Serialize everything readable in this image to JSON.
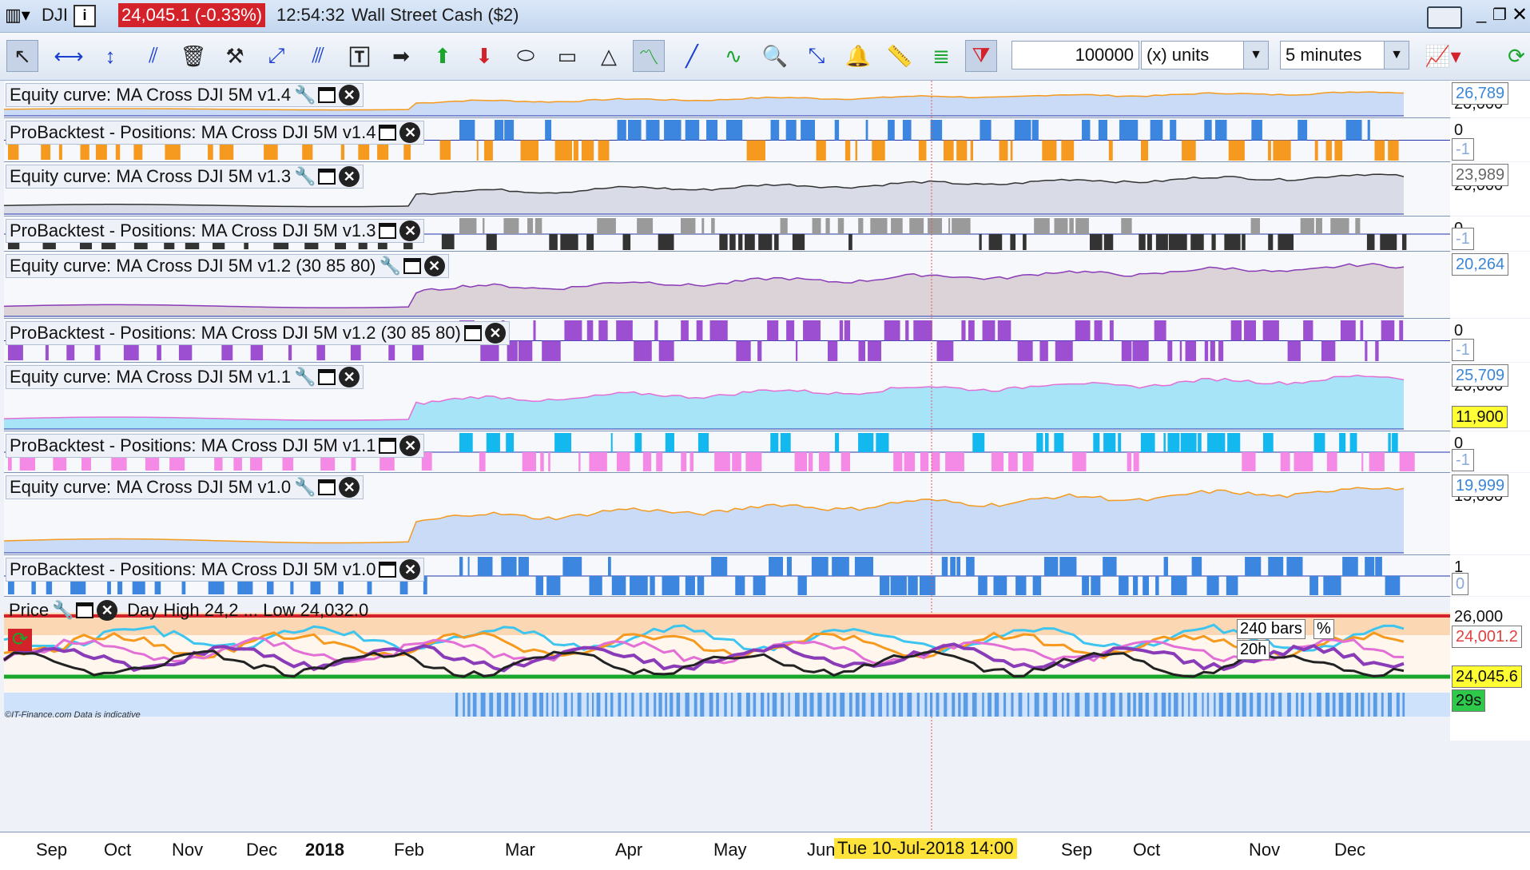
{
  "window": {
    "symbol": "DJI",
    "price_change": "24,045.1 (-0.33%)",
    "time": "12:54:32",
    "instrument": "Wall Street Cash ($2)"
  },
  "toolbar": {
    "quantity": "100000",
    "units_label": "(x) units",
    "timeframe": "5 minutes"
  },
  "panels": [
    {
      "label": "Equity curve: MA Cross DJI 5M v1.4",
      "axis_value": "26,789",
      "axis_tick": "20,000",
      "fill": "#c9dbf6",
      "line": "#f59a1e"
    },
    {
      "label": "ProBacktest - Positions: MA Cross DJI 5M v1.4",
      "axis_tick": "0",
      "axis_value": "-1",
      "bar_top": "#3d86e0",
      "bar_bottom": "#f59a1e"
    },
    {
      "label": "Equity curve: MA Cross DJI 5M v1.3",
      "axis_value": "23,989",
      "axis_tick": "20,000",
      "fill": "#d9dce6",
      "line": "#333333"
    },
    {
      "label": "ProBacktest - Positions: MA Cross DJI 5M v1.3",
      "axis_tick": "0",
      "axis_value": "-1",
      "bar_top": "#9a9a9a",
      "bar_bottom": "#333333"
    },
    {
      "label": "Equity curve: MA Cross DJI 5M v1.2 (30 85 80)",
      "axis_value": "20,264",
      "axis_tick": "",
      "fill": "#dcd3d8",
      "line": "#8a3bb8"
    },
    {
      "label": "ProBacktest - Positions: MA Cross DJI 5M v1.2 (30 85 80)",
      "axis_tick": "0",
      "axis_value": "-1",
      "bar_top": "#9c4fd0",
      "bar_bottom": "#9c4fd0"
    },
    {
      "label": "Equity curve: MA Cross DJI 5M v1.1",
      "axis_value": "25,709",
      "axis_tick": "20,000",
      "axis_value2": "11,900",
      "fill": "#a8e4f8",
      "line": "#e36fd6"
    },
    {
      "label": "ProBacktest - Positions: MA Cross DJI 5M v1.1",
      "axis_tick": "0",
      "axis_value": "-1",
      "bar_top": "#12b8ee",
      "bar_bottom": "#f48ae6"
    },
    {
      "label": "Equity curve: MA Cross DJI 5M v1.0",
      "axis_value": "19,999",
      "axis_tick": "15,000",
      "fill": "#c9dbf6",
      "line": "#f59a1e"
    },
    {
      "label": "ProBacktest - Positions: MA Cross DJI 5M v1.0",
      "axis_tick": "1",
      "axis_value": "0",
      "bar_top": "#3d86e0",
      "bar_bottom": "#3d86e0"
    }
  ],
  "price_panel": {
    "label": "Price",
    "info": "Day High 24,2 ... Low 24,032.0",
    "bars_label": "240 bars",
    "hours_label": "20h",
    "pct": "%",
    "axis_tick": "26,000",
    "axis_value_red": "24,001.2",
    "axis_value_last": "24,045.6",
    "countdown": "29s",
    "watermark": "©IT-Finance.com Data is indicative"
  },
  "time_axis": {
    "labels": [
      "Sep",
      "Oct",
      "Nov",
      "Dec",
      "2018",
      "Feb",
      "Mar",
      "Apr",
      "May",
      "Jun",
      "Sep",
      "Oct",
      "Nov",
      "Dec"
    ],
    "cursor": "Tue 10-Jul-2018 14:00"
  },
  "colors": {
    "price_chip": "#d3222a",
    "cursor_box": "#ffe33a"
  }
}
